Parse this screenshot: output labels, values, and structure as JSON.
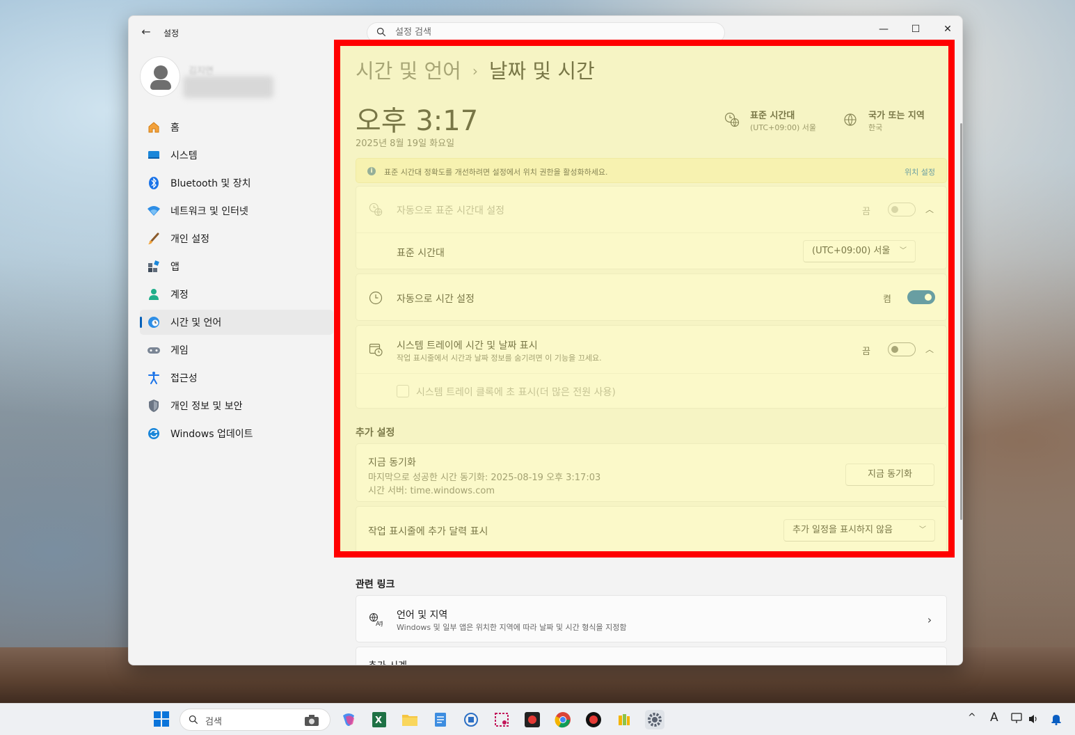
{
  "window": {
    "app_title": "설정",
    "search_placeholder": "설정 검색",
    "back": "←",
    "minimize": "—",
    "maximize": "☐",
    "close": "✕"
  },
  "profile": {
    "name": "김지연"
  },
  "sidebar": {
    "items": [
      {
        "label": "홈",
        "icon": "home-icon"
      },
      {
        "label": "시스템",
        "icon": "system-icon"
      },
      {
        "label": "Bluetooth 및 장치",
        "icon": "bluetooth-icon"
      },
      {
        "label": "네트워크 및 인터넷",
        "icon": "network-icon"
      },
      {
        "label": "개인 설정",
        "icon": "personalization-icon"
      },
      {
        "label": "앱",
        "icon": "apps-icon"
      },
      {
        "label": "계정",
        "icon": "accounts-icon"
      },
      {
        "label": "시간 및 언어",
        "icon": "time-language-icon",
        "active": true
      },
      {
        "label": "게임",
        "icon": "gaming-icon"
      },
      {
        "label": "접근성",
        "icon": "accessibility-icon"
      },
      {
        "label": "개인 정보 및 보안",
        "icon": "privacy-icon"
      },
      {
        "label": "Windows 업데이트",
        "icon": "windows-update-icon"
      }
    ]
  },
  "main": {
    "breadcrumb_parent": "시간 및 언어",
    "breadcrumb_sep": "›",
    "breadcrumb_current": "날짜 및 시간",
    "clock": "오후 3:17",
    "date": "2025년 8월 19일 화요일",
    "timezone": {
      "title": "표준 시간대",
      "value": "(UTC+09:00) 서울"
    },
    "region": {
      "title": "국가 또는 지역",
      "value": "한국"
    },
    "info": {
      "icon": "i",
      "text": "표준 시간대 정확도를 개선하려면 설정에서 위치 권한을 활성화하세요.",
      "link": "위치 설정"
    },
    "auto_timezone": {
      "label": "자동으로 표준 시간대 설정",
      "state": "끔",
      "on": false
    },
    "timezone_row": {
      "label": "표준 시간대",
      "value": "(UTC+09:00) 서울"
    },
    "auto_time": {
      "label": "자동으로 시간 설정",
      "state": "켬",
      "on": true
    },
    "tray": {
      "label": "시스템 트레이에 시간 및 날짜 표시",
      "sub": "작업 표시줄에서 시간과 날짜 정보를 숨기려면 이 기능을 끄세요.",
      "state": "끔",
      "on": false,
      "checkbox_label": "시스템 트레이 클록에 초 표시(더 많은 전원 사용)"
    },
    "additional_title": "추가 설정",
    "sync": {
      "title": "지금 동기화",
      "last": "마지막으로 성공한 시간 동기화: 2025-08-19 오후 3:17:03",
      "server": "시간 서버: time.windows.com",
      "button": "지금 동기화"
    },
    "calendar": {
      "label": "작업 표시줄에 추가 달력 표시",
      "value": "추가 일정을 표시하지 않음"
    },
    "related_title": "관련 링크",
    "language_region": {
      "title": "언어 및 지역",
      "sub": "Windows 및 일부 앱은 위치한 지역에 따라 날짜 및 시간 형식을 지정함"
    },
    "extra_clock": {
      "title": "추가 시계"
    }
  },
  "taskbar": {
    "search_label": "검색",
    "apps": [
      "camera-icon",
      "copilot-icon",
      "excel-icon",
      "file-explorer-icon",
      "notepad-icon",
      "network-app-icon",
      "snipping-tool-icon",
      "media-app-icon",
      "chrome-icon",
      "record-icon",
      "library-icon",
      "settings-icon"
    ],
    "tray": {
      "chevron": "^",
      "ime": "A"
    }
  },
  "colors": {
    "accent": "#005fb8",
    "highlight_border": "#ff0000",
    "highlight_fill": "#faf582"
  }
}
